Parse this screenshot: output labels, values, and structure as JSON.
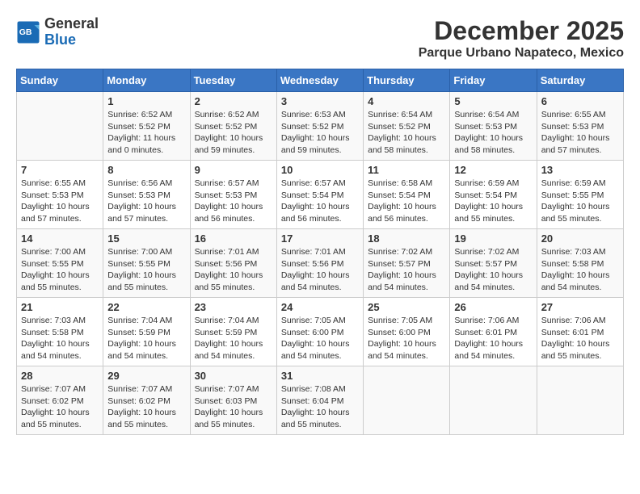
{
  "logo": {
    "general": "General",
    "blue": "Blue"
  },
  "title": "December 2025",
  "location": "Parque Urbano Napateco, Mexico",
  "days_of_week": [
    "Sunday",
    "Monday",
    "Tuesday",
    "Wednesday",
    "Thursday",
    "Friday",
    "Saturday"
  ],
  "weeks": [
    [
      {
        "day": "",
        "info": ""
      },
      {
        "day": "1",
        "info": "Sunrise: 6:52 AM\nSunset: 5:52 PM\nDaylight: 11 hours and 0 minutes."
      },
      {
        "day": "2",
        "info": "Sunrise: 6:52 AM\nSunset: 5:52 PM\nDaylight: 10 hours and 59 minutes."
      },
      {
        "day": "3",
        "info": "Sunrise: 6:53 AM\nSunset: 5:52 PM\nDaylight: 10 hours and 59 minutes."
      },
      {
        "day": "4",
        "info": "Sunrise: 6:54 AM\nSunset: 5:52 PM\nDaylight: 10 hours and 58 minutes."
      },
      {
        "day": "5",
        "info": "Sunrise: 6:54 AM\nSunset: 5:53 PM\nDaylight: 10 hours and 58 minutes."
      },
      {
        "day": "6",
        "info": "Sunrise: 6:55 AM\nSunset: 5:53 PM\nDaylight: 10 hours and 57 minutes."
      }
    ],
    [
      {
        "day": "7",
        "info": "Sunrise: 6:55 AM\nSunset: 5:53 PM\nDaylight: 10 hours and 57 minutes."
      },
      {
        "day": "8",
        "info": "Sunrise: 6:56 AM\nSunset: 5:53 PM\nDaylight: 10 hours and 57 minutes."
      },
      {
        "day": "9",
        "info": "Sunrise: 6:57 AM\nSunset: 5:53 PM\nDaylight: 10 hours and 56 minutes."
      },
      {
        "day": "10",
        "info": "Sunrise: 6:57 AM\nSunset: 5:54 PM\nDaylight: 10 hours and 56 minutes."
      },
      {
        "day": "11",
        "info": "Sunrise: 6:58 AM\nSunset: 5:54 PM\nDaylight: 10 hours and 56 minutes."
      },
      {
        "day": "12",
        "info": "Sunrise: 6:59 AM\nSunset: 5:54 PM\nDaylight: 10 hours and 55 minutes."
      },
      {
        "day": "13",
        "info": "Sunrise: 6:59 AM\nSunset: 5:55 PM\nDaylight: 10 hours and 55 minutes."
      }
    ],
    [
      {
        "day": "14",
        "info": "Sunrise: 7:00 AM\nSunset: 5:55 PM\nDaylight: 10 hours and 55 minutes."
      },
      {
        "day": "15",
        "info": "Sunrise: 7:00 AM\nSunset: 5:55 PM\nDaylight: 10 hours and 55 minutes."
      },
      {
        "day": "16",
        "info": "Sunrise: 7:01 AM\nSunset: 5:56 PM\nDaylight: 10 hours and 55 minutes."
      },
      {
        "day": "17",
        "info": "Sunrise: 7:01 AM\nSunset: 5:56 PM\nDaylight: 10 hours and 54 minutes."
      },
      {
        "day": "18",
        "info": "Sunrise: 7:02 AM\nSunset: 5:57 PM\nDaylight: 10 hours and 54 minutes."
      },
      {
        "day": "19",
        "info": "Sunrise: 7:02 AM\nSunset: 5:57 PM\nDaylight: 10 hours and 54 minutes."
      },
      {
        "day": "20",
        "info": "Sunrise: 7:03 AM\nSunset: 5:58 PM\nDaylight: 10 hours and 54 minutes."
      }
    ],
    [
      {
        "day": "21",
        "info": "Sunrise: 7:03 AM\nSunset: 5:58 PM\nDaylight: 10 hours and 54 minutes."
      },
      {
        "day": "22",
        "info": "Sunrise: 7:04 AM\nSunset: 5:59 PM\nDaylight: 10 hours and 54 minutes."
      },
      {
        "day": "23",
        "info": "Sunrise: 7:04 AM\nSunset: 5:59 PM\nDaylight: 10 hours and 54 minutes."
      },
      {
        "day": "24",
        "info": "Sunrise: 7:05 AM\nSunset: 6:00 PM\nDaylight: 10 hours and 54 minutes."
      },
      {
        "day": "25",
        "info": "Sunrise: 7:05 AM\nSunset: 6:00 PM\nDaylight: 10 hours and 54 minutes."
      },
      {
        "day": "26",
        "info": "Sunrise: 7:06 AM\nSunset: 6:01 PM\nDaylight: 10 hours and 54 minutes."
      },
      {
        "day": "27",
        "info": "Sunrise: 7:06 AM\nSunset: 6:01 PM\nDaylight: 10 hours and 55 minutes."
      }
    ],
    [
      {
        "day": "28",
        "info": "Sunrise: 7:07 AM\nSunset: 6:02 PM\nDaylight: 10 hours and 55 minutes."
      },
      {
        "day": "29",
        "info": "Sunrise: 7:07 AM\nSunset: 6:02 PM\nDaylight: 10 hours and 55 minutes."
      },
      {
        "day": "30",
        "info": "Sunrise: 7:07 AM\nSunset: 6:03 PM\nDaylight: 10 hours and 55 minutes."
      },
      {
        "day": "31",
        "info": "Sunrise: 7:08 AM\nSunset: 6:04 PM\nDaylight: 10 hours and 55 minutes."
      },
      {
        "day": "",
        "info": ""
      },
      {
        "day": "",
        "info": ""
      },
      {
        "day": "",
        "info": ""
      }
    ]
  ]
}
